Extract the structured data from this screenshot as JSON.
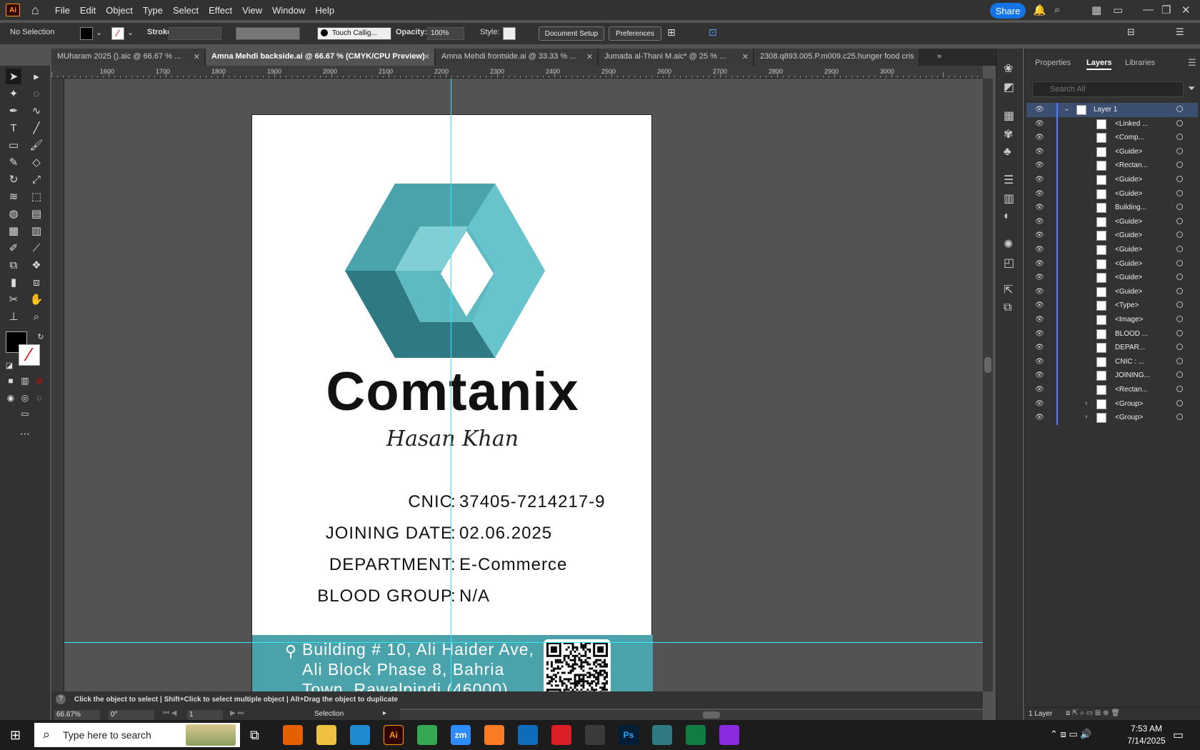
{
  "app": {
    "logo": "Ai"
  },
  "menu": [
    "File",
    "Edit",
    "Object",
    "Type",
    "Select",
    "Effect",
    "View",
    "Window",
    "Help"
  ],
  "share_label": "Share",
  "control_bar": {
    "selection": "No Selection",
    "stroke_label": "Stroke:",
    "brush": "Touch Callig...",
    "opacity_label": "Opacity:",
    "opacity_value": "100%",
    "style_label": "Style:",
    "document_setup": "Document Setup",
    "preferences": "Preferences"
  },
  "tabs": [
    {
      "label": "MUharam 2025 ().aic @ 66.67 % ...",
      "active": false
    },
    {
      "label": "Amna Mehdi  backside.ai @ 66.67 % (CMYK/CPU Preview)",
      "active": true
    },
    {
      "label": "Amna Mehdi  frontside.ai @ 33.33 % ...",
      "active": false
    },
    {
      "label": "Jumada al-Thani M.aic* @ 25 % ...",
      "active": false
    },
    {
      "label": "2308.q893.005.P.m009.c25.hunger food cris",
      "active": false
    }
  ],
  "ruler_labels": [
    "1600",
    "1700",
    "1800",
    "1900",
    "2000",
    "2100",
    "2200",
    "2300",
    "2400",
    "2500",
    "2600",
    "2700",
    "2800",
    "2900",
    "3000"
  ],
  "card": {
    "brand": "Comtanix",
    "signature": "Hasan Khan",
    "rows": [
      {
        "label": "CNIC",
        "sep": ":",
        "value": "37405-7214217-9"
      },
      {
        "label": "JOINING DATE",
        "sep": ":",
        "value": "02.06.2025"
      },
      {
        "label": "DEPARTMENT",
        "sep": ":",
        "value": "E-Commerce"
      },
      {
        "label": "BLOOD GROUP",
        "sep": ":",
        "value": "N/A"
      }
    ],
    "address_lines": [
      "Building # 10, Ali Haider Ave,",
      "Ali Block Phase 8, Bahria",
      "Town, Rawalpindi (46000)"
    ],
    "colors": {
      "teal_dark": "#2f7a82",
      "teal_mid": "#4aa3ab",
      "teal_light": "#67c4cc",
      "footer": "#4aa3ab"
    }
  },
  "status": {
    "hint": "Click the object to select  |  Shift+Click to select multiple object  |  Alt+Drag the object to duplicate",
    "zoom": "66.67%",
    "rotation": "0°",
    "artboard": "1",
    "tool": "Selection"
  },
  "panel": {
    "tabs": [
      "Properties",
      "Layers",
      "Libraries"
    ],
    "active_tab": "Layers",
    "search_placeholder": "Search All",
    "layers": [
      {
        "name": "Layer 1",
        "top": true
      },
      {
        "name": "<Linked ..."
      },
      {
        "name": "<Comp..."
      },
      {
        "name": "<Guide>"
      },
      {
        "name": "<Rectan..."
      },
      {
        "name": "<Guide>"
      },
      {
        "name": "<Guide>"
      },
      {
        "name": "Building..."
      },
      {
        "name": "<Guide>"
      },
      {
        "name": "<Guide>"
      },
      {
        "name": "<Guide>"
      },
      {
        "name": "<Guide>"
      },
      {
        "name": "<Guide>"
      },
      {
        "name": "<Guide>"
      },
      {
        "name": "<Type>"
      },
      {
        "name": "<Image>"
      },
      {
        "name": "BLOOD ..."
      },
      {
        "name": "DEPAR..."
      },
      {
        "name": "CNIC : ..."
      },
      {
        "name": "JOINING..."
      },
      {
        "name": "<Rectan..."
      },
      {
        "name": "<Group>",
        "expandable": true
      },
      {
        "name": "<Group>",
        "expandable": true
      }
    ],
    "footer": "1 Layer"
  },
  "taskbar": {
    "search_placeholder": "Type here to search",
    "time": "7:53 AM",
    "date": "7/14/2025",
    "apps": [
      {
        "name": "firefox",
        "label": "",
        "color": "#e66000"
      },
      {
        "name": "file-explorer",
        "label": "",
        "color": "#f0c040"
      },
      {
        "name": "vscode",
        "label": "",
        "color": "#1f8ad2"
      },
      {
        "name": "illustrator",
        "label": "Ai",
        "color": "#330000"
      },
      {
        "name": "chrome",
        "label": "",
        "color": "#34a853"
      },
      {
        "name": "zoom",
        "label": "zm",
        "color": "#2d8cff"
      },
      {
        "name": "xampp",
        "label": "",
        "color": "#fb7a24"
      },
      {
        "name": "outlook",
        "label": "",
        "color": "#0f6cbd"
      },
      {
        "name": "creative-cloud",
        "label": "",
        "color": "#da1f26"
      },
      {
        "name": "pen-tool",
        "label": "",
        "color": "#3a3a3a"
      },
      {
        "name": "photoshop",
        "label": "Ps",
        "color": "#001e36"
      },
      {
        "name": "app-diamond",
        "label": "",
        "color": "#2f7a82"
      },
      {
        "name": "excel",
        "label": "",
        "color": "#107c41"
      },
      {
        "name": "winrar",
        "label": "",
        "color": "#8a2be2"
      }
    ]
  }
}
